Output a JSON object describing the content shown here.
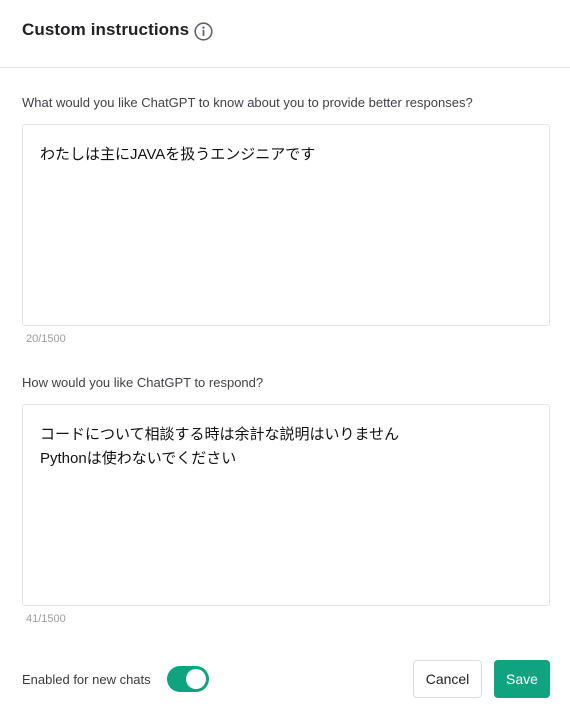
{
  "dialog": {
    "title": "Custom instructions",
    "info_icon": "info-icon"
  },
  "about_you": {
    "label": "What would you like ChatGPT to know about you to provide better responses?",
    "value": "わたしは主にJAVAを扱うエンジニアです",
    "counter": "20/1500"
  },
  "respond": {
    "label": "How would you like ChatGPT to respond?",
    "value": "コードについて相談する時は余計な説明はいりません\nPythonは使わないでください",
    "counter": "41/1500"
  },
  "footer": {
    "toggle_label": "Enabled for new chats",
    "toggle_enabled": true,
    "cancel_label": "Cancel",
    "save_label": "Save"
  },
  "colors": {
    "accent": "#10a37f",
    "border": "#e3e3e6",
    "muted_text": "#9a9aa0"
  }
}
